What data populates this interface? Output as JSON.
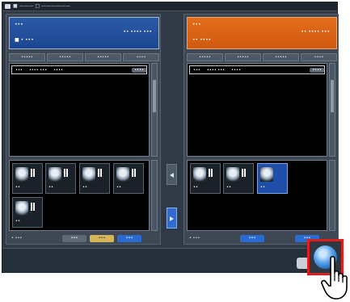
{
  "window": {
    "title": "■ ——— □ ——————"
  },
  "left_panel": {
    "header_label": "•••",
    "header_name": "■ • •••",
    "header_date": "•• •••• •••",
    "tabs": [
      "•••••",
      "•••••",
      "•••••",
      "••••"
    ],
    "infobar": [
      "•••",
      "•••• •••",
      "••••"
    ],
    "edit_label": "••••",
    "thumbs": [
      "••",
      "••",
      "••",
      "••",
      "••"
    ],
    "count": "• •••",
    "buttons": [
      "•••",
      "•••",
      "•••"
    ]
  },
  "right_panel": {
    "header_label": "•••",
    "header_name": "•• ••••",
    "header_date": "•• •••• •••",
    "tabs": [
      "•••••",
      "•••••",
      "•••••",
      "••••"
    ],
    "infobar": [
      "•••",
      "•••• •••",
      "••••"
    ],
    "edit_label": "••••",
    "thumbs": [
      "••",
      "••",
      "••"
    ],
    "selected_thumb": 2,
    "count": "• •••",
    "buttons": [
      "•••",
      "•••"
    ]
  },
  "colors": {
    "left_header": "#2b5aa8",
    "right_header": "#e46d1b",
    "highlight_box": "#e01e1e",
    "selected_thumb": "#1f4ea8"
  },
  "icons": {
    "ok_button": "globe-ok-icon",
    "pointer": "hand-pointer-icon",
    "move_right": "arrow-right-icon",
    "move_left": "arrow-left-icon"
  }
}
